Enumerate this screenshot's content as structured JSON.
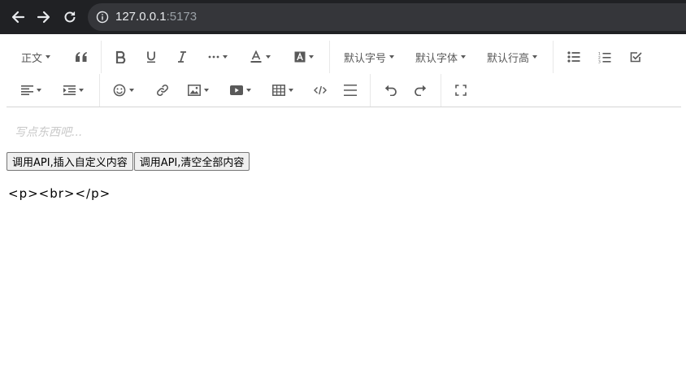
{
  "browser": {
    "url_host": "127.0.0.1",
    "url_port": ":5173"
  },
  "toolbar": {
    "row1": {
      "header_label": "正文",
      "font_size_label": "默认字号",
      "font_family_label": "默认字体",
      "line_height_label": "默认行高"
    }
  },
  "editor": {
    "placeholder": "写点东西吧..."
  },
  "buttons": {
    "insert_label": "调用API,插入自定义内容",
    "clear_label": "调用API,清空全部内容"
  },
  "output": {
    "html": "<p><br></p>"
  }
}
